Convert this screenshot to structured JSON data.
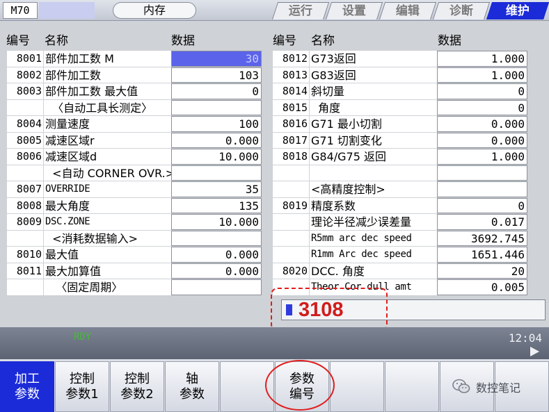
{
  "header": {
    "model": "M70",
    "memory": "内存",
    "tabs": [
      {
        "label": "运行",
        "active": false
      },
      {
        "label": "设置",
        "active": false
      },
      {
        "label": "编辑",
        "active": false
      },
      {
        "label": "诊断",
        "active": false
      },
      {
        "label": "维护",
        "active": true
      }
    ]
  },
  "columns": {
    "no": "编号",
    "name": "名称",
    "value": "数据"
  },
  "left_table": [
    {
      "no": "8001",
      "name": "部件加工数 M",
      "value": "30",
      "selected": true
    },
    {
      "no": "8002",
      "name": "部件加工数",
      "value": "103"
    },
    {
      "no": "8003",
      "name": "部件加工数 最大值",
      "value": "0"
    },
    {
      "no": "",
      "name": "  〈自动工具长测定〉",
      "value": ""
    },
    {
      "no": "8004",
      "name": "测量速度",
      "value": "100"
    },
    {
      "no": "8005",
      "name": "减速区域r",
      "value": "0.000"
    },
    {
      "no": "8006",
      "name": "减速区域d",
      "value": "10.000"
    },
    {
      "no": "",
      "name": "  <自动 CORNER OVR.>",
      "value": ""
    },
    {
      "no": "8007",
      "name": "OVERRIDE",
      "value": "35",
      "mono": true
    },
    {
      "no": "8008",
      "name": "最大角度",
      "value": "135"
    },
    {
      "no": "8009",
      "name": "DSC.ZONE",
      "value": "10.000",
      "mono": true
    },
    {
      "no": "",
      "name": "  <消耗数据输入>",
      "value": ""
    },
    {
      "no": "8010",
      "name": "最大值",
      "value": "0.000"
    },
    {
      "no": "8011",
      "name": "最大加算值",
      "value": "0.000"
    },
    {
      "no": "",
      "name": "   〈固定周期〉",
      "value": ""
    }
  ],
  "right_table": [
    {
      "no": "8012",
      "name": "G73返回",
      "value": "1.000"
    },
    {
      "no": "8013",
      "name": "G83返回",
      "value": "1.000"
    },
    {
      "no": "8014",
      "name": "斜切量",
      "value": "0"
    },
    {
      "no": "8015",
      "name": "  角度",
      "value": "0"
    },
    {
      "no": "8016",
      "name": "G71 最小切割",
      "value": "0.000"
    },
    {
      "no": "8017",
      "name": "G71 切割变化",
      "value": "0.000"
    },
    {
      "no": "8018",
      "name": "G84/G75 返回",
      "value": "1.000"
    },
    {
      "no": "",
      "name": "",
      "value": ""
    },
    {
      "no": "",
      "name": "<高精度控制>",
      "value": ""
    },
    {
      "no": "8019",
      "name": "精度系数",
      "value": "0"
    },
    {
      "no": "",
      "name": "理论半径减少误差量",
      "value": "0.017"
    },
    {
      "no": "",
      "name": "R5mm arc dec speed",
      "value": "3692.745",
      "mono": true
    },
    {
      "no": "",
      "name": "R1mm Arc dec speed",
      "value": "1651.446",
      "mono": true
    },
    {
      "no": "8020",
      "name": "DCC. 角度",
      "value": "20"
    },
    {
      "no": "",
      "name": "Theor Cor dull amt",
      "value": "0.005",
      "mono": true
    }
  ],
  "input": {
    "value": "3108"
  },
  "status": {
    "state": "RDY",
    "time": "12:04"
  },
  "menu": [
    {
      "label": "加工\n参数",
      "active": true
    },
    {
      "label": "控制\n参数1",
      "active": false
    },
    {
      "label": "控制\n参数2",
      "active": false
    },
    {
      "label": "轴\n参数",
      "active": false
    },
    {
      "label": "",
      "active": false
    },
    {
      "label": "参数\n编号",
      "active": false
    },
    {
      "label": "",
      "active": false
    },
    {
      "label": "",
      "active": false
    },
    {
      "label": "",
      "active": false
    },
    {
      "label": "",
      "active": false
    }
  ],
  "watermark": "数控笔记",
  "colors": {
    "accent": "#1b2bd8",
    "selected": "#5b63ea",
    "highlight": "#e01d1d",
    "ready": "#47b83a"
  }
}
